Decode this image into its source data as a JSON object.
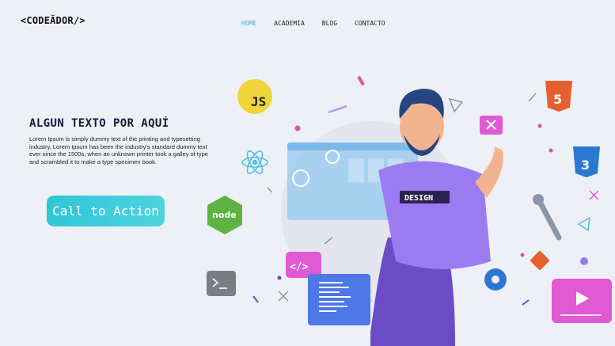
{
  "logo": {
    "text": "<CODEĂDOR/>"
  },
  "nav": {
    "items": [
      {
        "label": "HOME",
        "active": true
      },
      {
        "label": "ACADEMIA",
        "active": false
      },
      {
        "label": "BLOG",
        "active": false
      },
      {
        "label": "CONTACTO",
        "active": false
      }
    ]
  },
  "hero": {
    "title": "ALGUN TEXTO POR AQUÍ",
    "body": "Lorem Ipsum is simply dummy text of the printing and typesetting industry. Lorem Ipsum has been the industry's standard dummy text ever since the 1500s, when an unknown printer took a galley of type and scrambled it to make a type specimen book.",
    "cta_label": "Call to Action"
  },
  "illustration": {
    "js_badge": "JS",
    "node_badge": "node",
    "html_badge": "5",
    "css_badge": "3",
    "shirt_text": "DESIGN",
    "colors": {
      "accent": "#35b6d6",
      "purple": "#9b7cf0",
      "js": "#f0d53a",
      "html": "#e6602e",
      "css": "#2b78d3",
      "node": "#5fb342"
    }
  }
}
